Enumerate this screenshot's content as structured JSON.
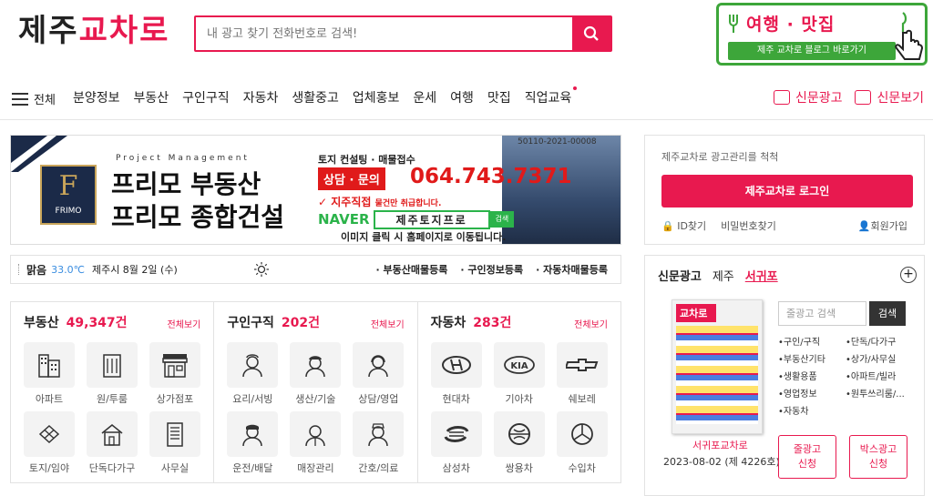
{
  "brand": {
    "logo_part1": "제주",
    "logo_part2": "교차로",
    "accent": "#e8194f",
    "green": "#3da63a"
  },
  "search": {
    "placeholder": "내 광고 찾기 전화번호로 검색!"
  },
  "promo": {
    "title": "여행 · 맛집",
    "subtitle": "제주 교차로 블로그 바로가기"
  },
  "nav": {
    "all_label": "전체",
    "items": [
      "분양정보",
      "부동산",
      "구인구직",
      "자동차",
      "생활중고",
      "업체홍보",
      "운세",
      "여행",
      "맛집",
      "직업교육"
    ],
    "ad_label": "신문광고",
    "view_label": "신문보기"
  },
  "banner": {
    "tag": "Project Management",
    "name1": "프리모 부동산",
    "name2": "프리모 종합건설",
    "brand": "FRIMO",
    "reg": "50110-2021-00008",
    "consult": "토지 컨설팅 · 매물접수",
    "inquiry": "상담 · 문의",
    "phone": "064.743.7371",
    "direct": "✓ 지주직접",
    "direct_sub": "물건만 취급합니다.",
    "naver": "NAVER",
    "naver_q": "제주토지프로",
    "naver_btn": "검색",
    "click": "이미지 클릭 시 홈페이지로 이동됩니다."
  },
  "weather": {
    "status": "맑음",
    "temp": "33.0℃",
    "date": "제주시 8월 2일 (수)",
    "links": [
      "부동산매물등록",
      "구인정보등록",
      "자동차매물등록"
    ]
  },
  "sections": [
    {
      "title": "부동산",
      "count": "49,347건",
      "more": "전체보기",
      "items": [
        "아파트",
        "원/투룸",
        "상가점포",
        "토지/임야",
        "단독다가구",
        "사무실"
      ]
    },
    {
      "title": "구인구직",
      "count": "202건",
      "more": "전체보기",
      "items": [
        "요리/서빙",
        "생산/기술",
        "상담/영업",
        "운전/배달",
        "매장관리",
        "간호/의료"
      ]
    },
    {
      "title": "자동차",
      "count": "283건",
      "more": "전체보기",
      "items": [
        "현대차",
        "기아차",
        "쉐보레",
        "삼성차",
        "쌍용차",
        "수입차"
      ]
    }
  ],
  "login": {
    "message": "제주교차로 광고관리를 척척",
    "button": "제주교차로 로그인",
    "find_id": "ID찾기",
    "find_pw": "비밀번호찾기",
    "signup": "회원가입"
  },
  "newspaper": {
    "title": "신문광고",
    "tabs": [
      "제주",
      "서귀포"
    ],
    "paper_name": "서귀포교차로",
    "paper_date": "2023-08-02 (제 4226호)",
    "search_placeholder": "줄광고 검색",
    "search_btn": "검색",
    "cats": [
      "구인/구직",
      "단독/다가구",
      "부동산기타",
      "상가/사무실",
      "생활용품",
      "아파트/빌라",
      "영업정보",
      "원투쓰리룸/...",
      "자동차"
    ],
    "btn_line1": "줄광고",
    "btn_line2": "신청",
    "btn_box1": "박스광고",
    "btn_box2": "신청",
    "cover_logo": "교차로"
  }
}
